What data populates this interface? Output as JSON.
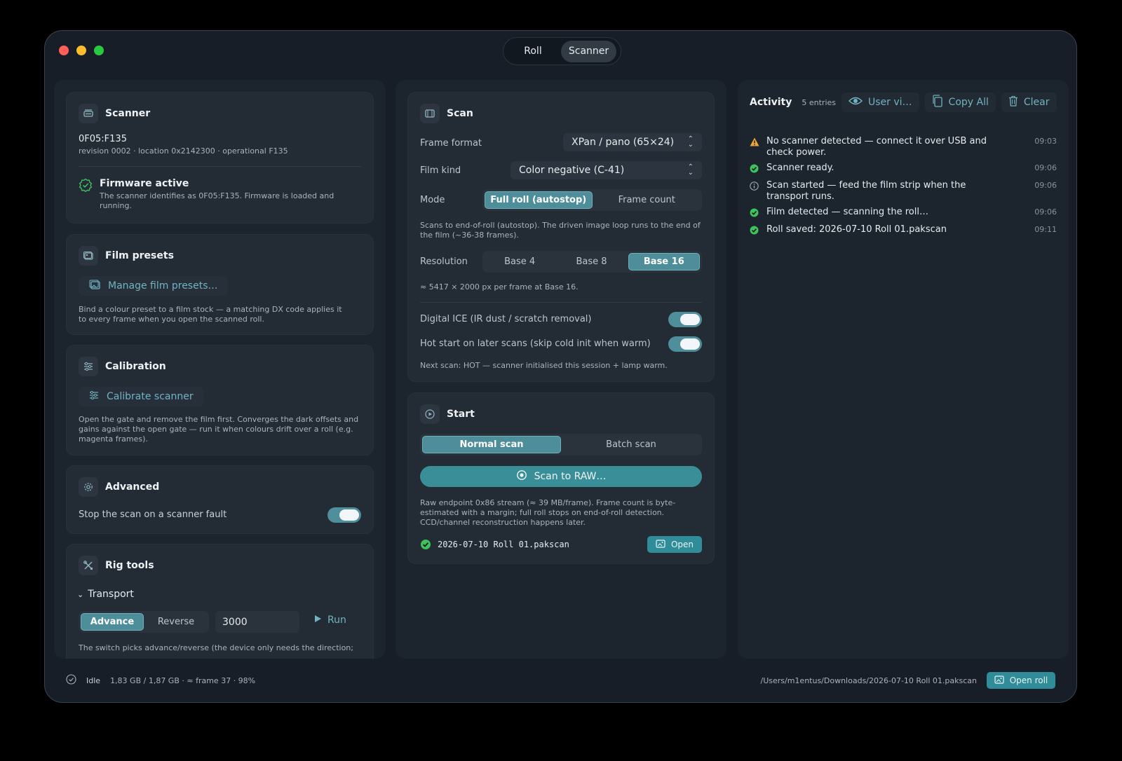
{
  "top_tabs": {
    "roll": "Roll",
    "scanner": "Scanner",
    "active": "Scanner"
  },
  "scanner_card": {
    "title": "Scanner",
    "device_id": "0F05:F135",
    "details": "revision 0002 · location 0x2142300 · operational F135",
    "firmware_title": "Firmware active",
    "firmware_desc": "The scanner identifies as 0F05:F135. Firmware is loaded and running."
  },
  "presets_card": {
    "title": "Film presets",
    "button": "Manage film presets…",
    "desc": "Bind a colour preset to a film stock — a matching DX code applies it to every frame when you open the scanned roll."
  },
  "calibration_card": {
    "title": "Calibration",
    "button": "Calibrate scanner",
    "desc": "Open the gate and remove the film first. Converges the dark offsets and gains against the open gate — run it when colours drift over a roll (e.g. magenta frames)."
  },
  "advanced_card": {
    "title": "Advanced",
    "stop_label": "Stop the scan on a scanner fault",
    "stop_on": true
  },
  "rig_card": {
    "title": "Rig tools",
    "transport_label": "Transport",
    "advance": "Advance",
    "reverse": "Reverse",
    "steps_value": "3000",
    "run": "Run",
    "note": "The switch picks advance/reverse (the device only needs the direction;"
  },
  "scan_card": {
    "title": "Scan",
    "frame_format_label": "Frame format",
    "frame_format_value": "XPan / pano (65×24)",
    "film_kind_label": "Film kind",
    "film_kind_value": "Color negative (C-41)",
    "mode_label": "Mode",
    "mode_options": [
      "Full roll (autostop)",
      "Frame count"
    ],
    "mode_active": 0,
    "mode_desc": "Scans to end-of-roll (autostop). The driven image loop runs to the end of the film (~36-38 frames).",
    "resolution_label": "Resolution",
    "resolution_options": [
      "Base 4",
      "Base 8",
      "Base 16"
    ],
    "resolution_active": 2,
    "resolution_desc": "≈ 5417 × 2000 px per frame at Base 16.",
    "ice_label": "Digital ICE (IR dust / scratch removal)",
    "ice_on": true,
    "hot_label": "Hot start on later scans (skip cold init when warm)",
    "hot_on": true,
    "next_scan": "Next scan: HOT — scanner initialised this session + lamp warm."
  },
  "start_card": {
    "title": "Start",
    "mode_options": [
      "Normal scan",
      "Batch scan"
    ],
    "mode_active": 0,
    "scan_button": "Scan to RAW…",
    "desc": "Raw endpoint 0x86 stream (≈ 39 MB/frame). Frame count is byte-estimated with a margin; full roll stops on end-of-roll detection. CCD/channel reconstruction happens later.",
    "file_name": "2026-07-10 Roll 01.pakscan",
    "open_button": "Open"
  },
  "activity": {
    "title": "Activity",
    "count": "5 entries",
    "user_view": "User vi…",
    "copy_all": "Copy All",
    "clear": "Clear",
    "entries": [
      {
        "level": "warning",
        "text": "No scanner detected — connect it over USB and check power.",
        "time": "09:03"
      },
      {
        "level": "success",
        "text": "Scanner ready.",
        "time": "09:06"
      },
      {
        "level": "info",
        "text": "Scan started — feed the film strip when the transport runs.",
        "time": "09:06"
      },
      {
        "level": "success",
        "text": "Film detected — scanning the roll…",
        "time": "09:06"
      },
      {
        "level": "success",
        "text": "Roll saved: 2026-07-10 Roll 01.pakscan",
        "time": "09:11"
      }
    ]
  },
  "status_bar": {
    "state": "Idle",
    "progress": "1,83 GB / 1,87 GB · ≈ frame 37 · 98%",
    "path": "/Users/m1entus/Downloads/2026-07-10 Roll 01.pakscan",
    "open_roll": "Open roll"
  },
  "colors": {
    "accent": "#3a8e98",
    "accent_link": "#6fb4c0",
    "warning": "#f0a53a",
    "success": "#3fc15c"
  }
}
